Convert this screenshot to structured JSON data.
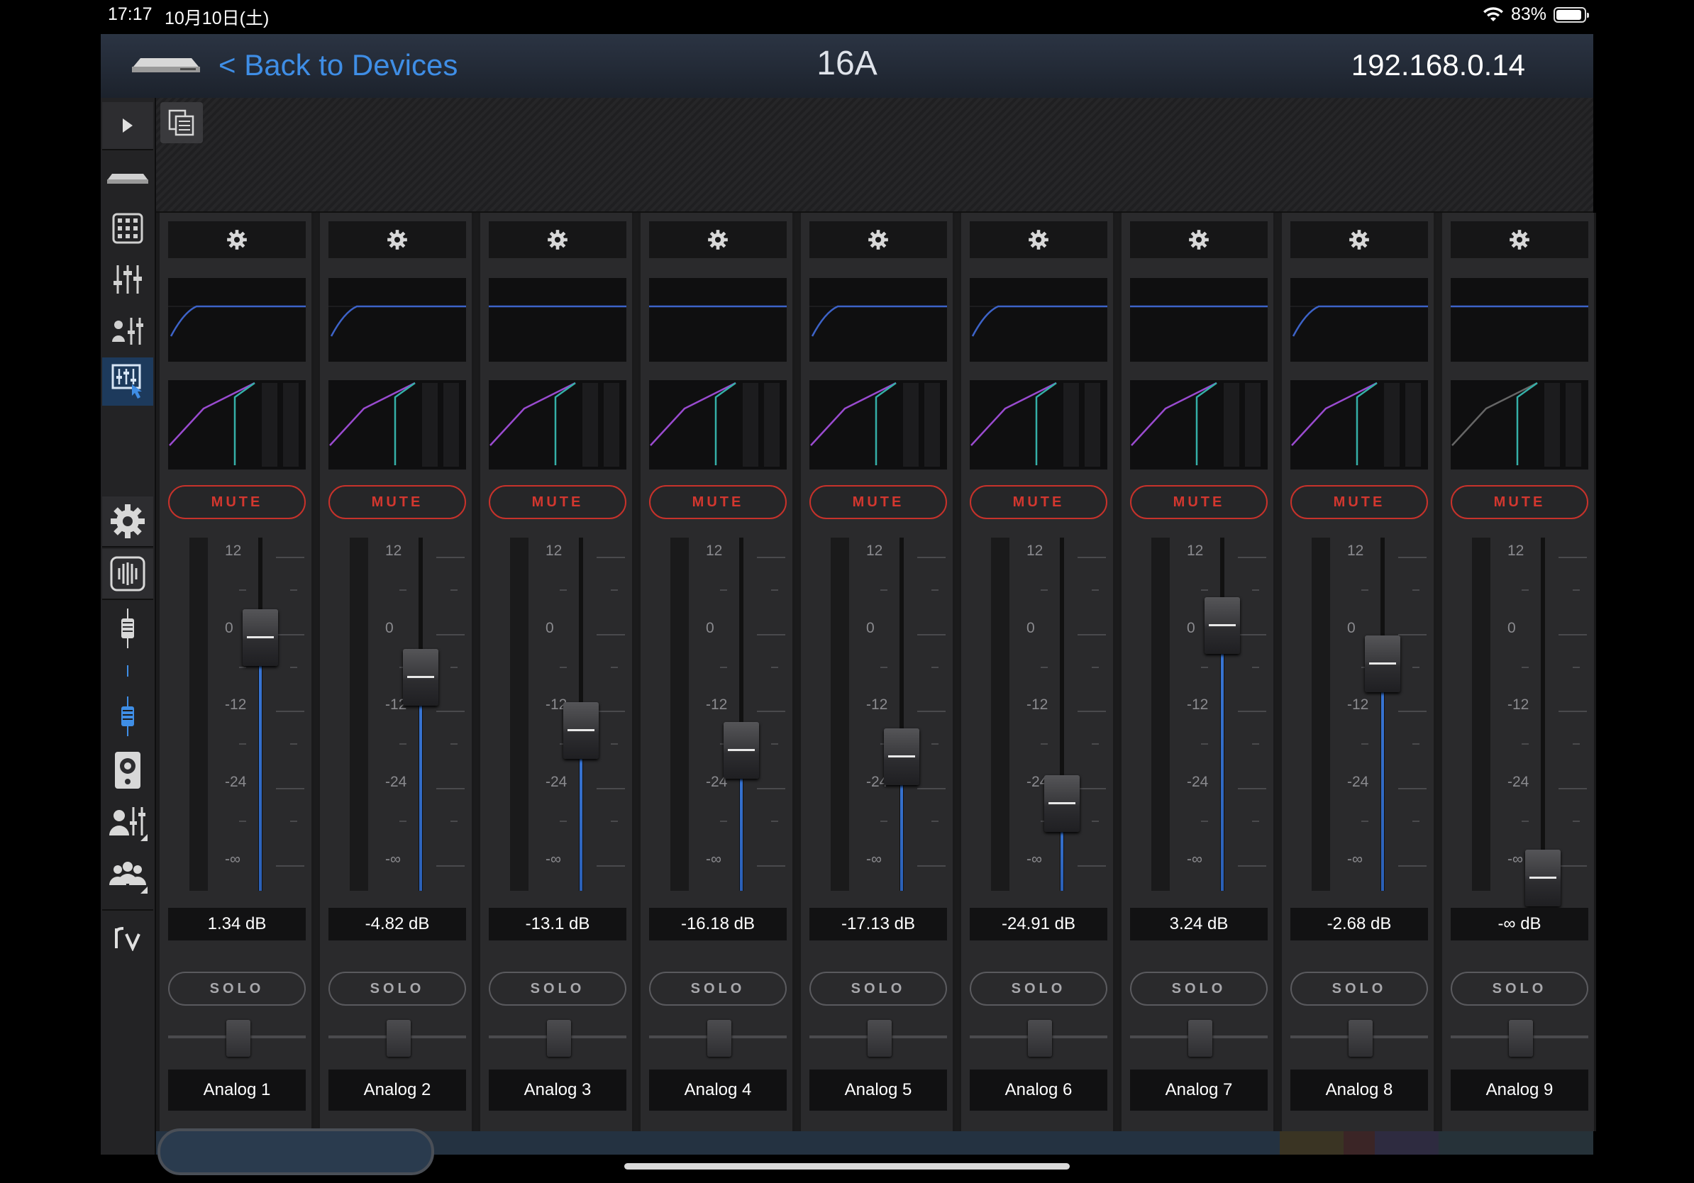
{
  "status_bar": {
    "time": "17:17",
    "date": "10月10日(土)",
    "battery": "83%"
  },
  "header": {
    "back_label": "< Back to Devices",
    "device_name": "16A",
    "ip_address": "192.168.0.14"
  },
  "sidebar": {
    "items": [
      "play-toggle-icon",
      "device-icon",
      "matrix-grid-icon",
      "mixer-faders-icon",
      "sends-faders-icon",
      "touch-mixer-icon",
      "gear-icon",
      "speaker-panel-icon",
      "channel-strip-icon",
      "channel-strip-selected-icon",
      "monitor-speaker-icon",
      "user-mix-icon",
      "group-icon",
      "rv-logo-icon"
    ]
  },
  "channel_labels": {
    "mute": "MUTE",
    "solo": "SOLO"
  },
  "scale_labels": [
    "12",
    "0",
    "-12",
    "-24",
    "-∞"
  ],
  "channels": [
    {
      "name": "Analog 1",
      "gain": "1.34 dB",
      "fader_db": 1.34,
      "hpf": true,
      "muted_style": "active"
    },
    {
      "name": "Analog 2",
      "gain": "-4.82 dB",
      "fader_db": -4.82,
      "hpf": true
    },
    {
      "name": "Analog 3",
      "gain": "-13.1 dB",
      "fader_db": -13.1,
      "hpf": false
    },
    {
      "name": "Analog 4",
      "gain": "-16.18 dB",
      "fader_db": -16.18,
      "hpf": false
    },
    {
      "name": "Analog 5",
      "gain": "-17.13 dB",
      "fader_db": -17.13,
      "hpf": true
    },
    {
      "name": "Analog 6",
      "gain": "-24.91 dB",
      "fader_db": -24.91,
      "hpf": true
    },
    {
      "name": "Analog 7",
      "gain": "3.24 dB",
      "fader_db": 3.24,
      "hpf": false
    },
    {
      "name": "Analog 8",
      "gain": "-2.68 dB",
      "fader_db": -2.68,
      "hpf": true
    },
    {
      "name": "Analog 9",
      "gain": "-∞ dB",
      "fader_db": null,
      "hpf": false
    }
  ],
  "colors": {
    "accent": "#3f8ee6",
    "mute": "#d3372f",
    "eq_curve": "#3d63c8",
    "comp_curve": "#9a4bd0",
    "gate_curve": "#35b0a8"
  }
}
